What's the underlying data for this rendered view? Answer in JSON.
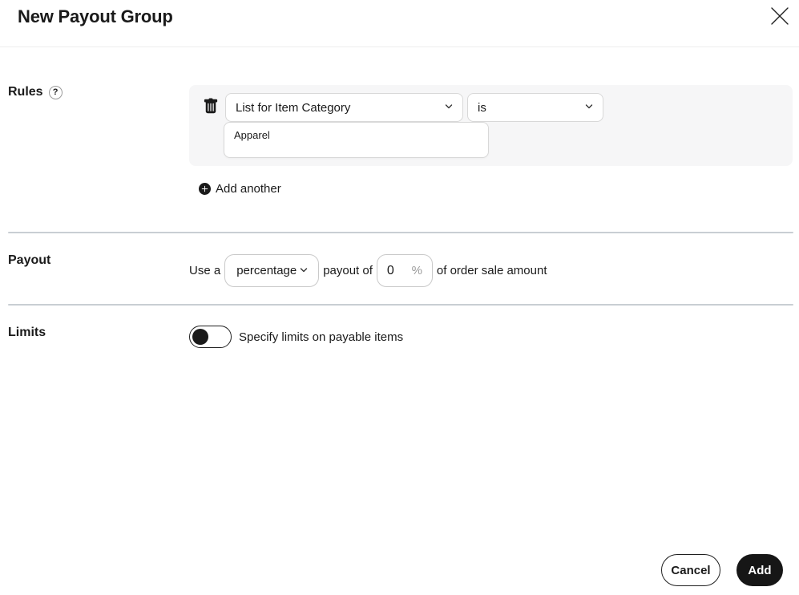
{
  "window": {
    "title": "New Payout Group"
  },
  "rules": {
    "label": "Rules",
    "help": "?",
    "rule": {
      "field": "List for Item Category",
      "operator": "is",
      "value": "Apparel"
    },
    "add_another": "Add another"
  },
  "payout": {
    "label": "Payout",
    "prefix": "Use a",
    "type": "percentage",
    "middle": "payout of",
    "amount": "0",
    "unit": "%",
    "suffix": "of order sale amount"
  },
  "limits": {
    "label": "Limits",
    "toggle_state": "off",
    "description": "Specify limits on payable items"
  },
  "footer": {
    "cancel": "Cancel",
    "add": "Add"
  },
  "icons": {
    "close": "close-icon",
    "help": "question-circle-icon",
    "trash": "trash-icon",
    "add": "plus-circle-icon",
    "chevron": "chevron-down-icon"
  },
  "colors": {
    "primary": "#1a1a1a",
    "panel_bg": "#f6f6f7",
    "control_border": "#d8d8d8",
    "divider": "#c9ced3",
    "muted_text": "#9a9a9a"
  }
}
